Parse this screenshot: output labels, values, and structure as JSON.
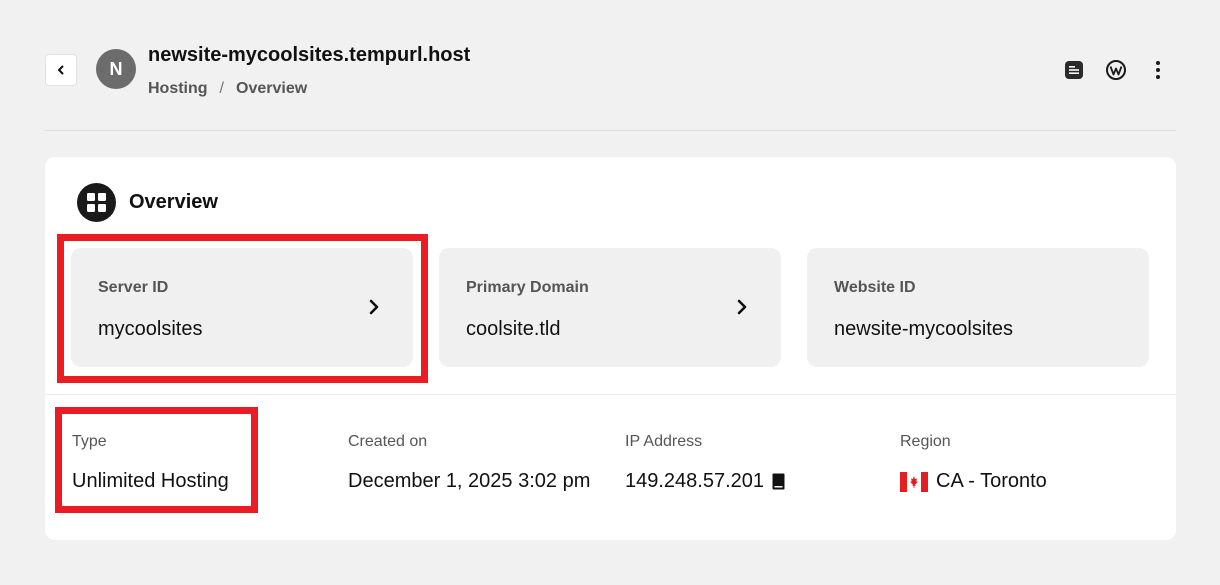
{
  "header": {
    "avatar_letter": "N",
    "site_title": "newsite-mycoolsites.tempurl.host",
    "breadcrumb": [
      "Hosting",
      "/",
      "Overview"
    ],
    "actions": [
      "notes-icon",
      "wordpress-icon",
      "more-vertical-icon"
    ]
  },
  "overview": {
    "title": "Overview",
    "tiles": [
      {
        "label": "Server ID",
        "value": "mycoolsites"
      },
      {
        "label": "Primary Domain",
        "value": "coolsite.tld"
      },
      {
        "label": "Website ID",
        "value": "newsite-mycoolsites"
      }
    ],
    "info": [
      {
        "label": "Type",
        "value": "Unlimited Hosting"
      },
      {
        "label": "Created on",
        "value": "December 1, 2025 3:02 pm"
      },
      {
        "label": "IP Address",
        "value": "149.248.57.201"
      },
      {
        "label": "Region",
        "value": "CA - Toronto"
      }
    ]
  },
  "colors": {
    "highlight": "#ec1c24",
    "card_bg": "#ffffff",
    "tile_bg": "#f0f0f0",
    "page_bg": "#f1f1f1"
  }
}
